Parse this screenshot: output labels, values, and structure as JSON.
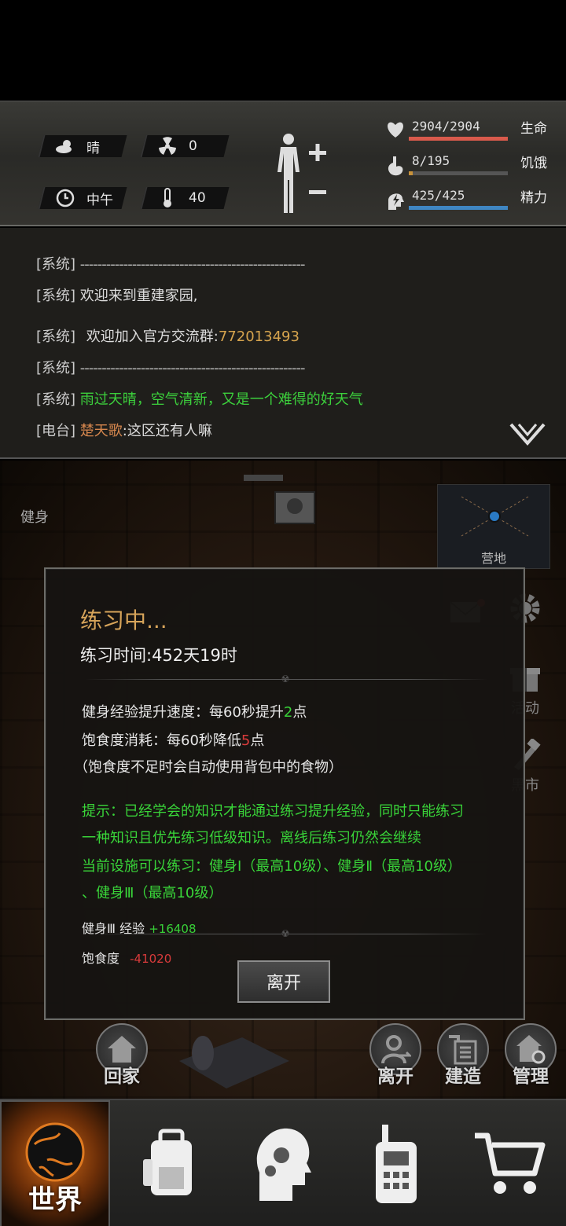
{
  "status": {
    "weather": "晴",
    "radiation": "0",
    "time_of_day": "中午",
    "temperature": "40",
    "health": {
      "text": "2904/2904",
      "label": "生命",
      "fraction": 1.0,
      "color": "#d95a4c"
    },
    "hunger": {
      "text": "8/195",
      "label": "饥饿",
      "fraction": 0.04,
      "color": "#c8923a"
    },
    "energy": {
      "text": "425/425",
      "label": "精力",
      "fraction": 1.0,
      "color": "#3f86c2"
    }
  },
  "chat": {
    "lines": [
      {
        "tag": "[系统]",
        "text": "----------------------------------------------------",
        "type": "sep"
      },
      {
        "tag": "[系统]",
        "text": "欢迎来到重建家园,",
        "type": "normal"
      },
      {
        "tag": "[系统]",
        "prefix": "欢迎加入官方交流群:",
        "text": "772013493",
        "type": "group"
      },
      {
        "tag": "[系统]",
        "text": "----------------------------------------------------",
        "type": "sep"
      },
      {
        "tag": "[系统]",
        "text": "雨过天晴，空气清新，又是一个难得的好天气",
        "type": "green"
      },
      {
        "tag": "[电台]",
        "speaker": "楚天歌",
        "text": ":这区还有人嘛",
        "type": "radio"
      }
    ]
  },
  "scene": {
    "label": "健身",
    "minimap_label": "营地",
    "side_buttons": {
      "activity": "活动",
      "black_market": "黑市"
    }
  },
  "dialog": {
    "title": "练习中...",
    "practice_time": "练习时间:452天19时",
    "exp_rate_pre": "健身经验提升速度：每60秒提升",
    "exp_rate_num": "2",
    "exp_rate_post": "点",
    "food_rate_pre": "饱食度消耗：每60秒降低",
    "food_rate_num": "5",
    "food_rate_post": "点",
    "food_note": "（饱食度不足时会自动使用背包中的食物）",
    "tip_1": "提示：已经学会的知识才能通过练习提升经验，同时只能练习",
    "tip_2": "一种知识且优先练习低级知识。离线后练习仍然会继续",
    "tip_3": "当前设施可以练习：健身Ⅰ（最高10级）、健身Ⅱ（最高10级）",
    "tip_4": "、健身Ⅲ（最高10级）",
    "result_exp_label": "健身Ⅲ 经验",
    "result_exp_value": "+16408",
    "result_food_label": "饱食度",
    "result_food_value": "-41020",
    "leave_button": "离开"
  },
  "actions": {
    "home": "回家",
    "leave": "离开",
    "build": "建造",
    "manage": "管理"
  },
  "nav": {
    "world": "世界"
  }
}
